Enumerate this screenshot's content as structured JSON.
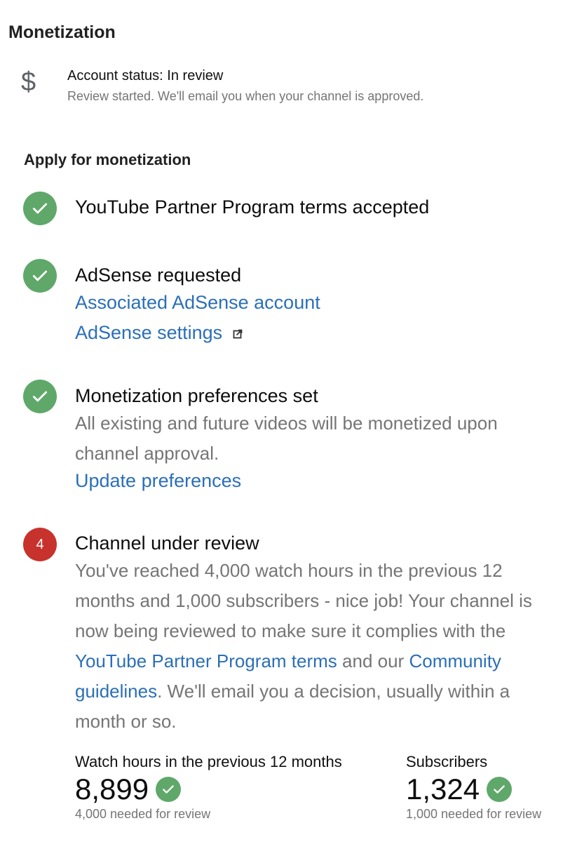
{
  "page": {
    "title": "Monetization"
  },
  "account_status": {
    "icon": "dollar-icon",
    "title": "Account status: In review",
    "description": "Review started. We'll email you when your channel is approved."
  },
  "apply": {
    "heading": "Apply for monetization",
    "steps": [
      {
        "status": "done",
        "icon": "check-icon",
        "title": "YouTube Partner Program terms accepted"
      },
      {
        "status": "done",
        "icon": "check-icon",
        "title": "AdSense requested",
        "links": [
          "Associated AdSense account",
          "AdSense settings"
        ]
      },
      {
        "status": "done",
        "icon": "check-icon",
        "title": "Monetization preferences set",
        "description_lines": [
          "All existing and future videos will be monetized upon",
          "channel approval."
        ],
        "link": "Update preferences"
      },
      {
        "status": "pending",
        "number": "4",
        "title": "Channel under review",
        "description": {
          "line1": "You've reached 4,000 watch hours in the previous 12",
          "line2": "months and 1,000 subscribers - nice job! Your channel is",
          "line3": "now being reviewed to make sure it complies with the",
          "link1": "YouTube Partner Program terms",
          "mid": " and our ",
          "link2a": "Community",
          "link2b": "guidelines",
          "after": ". We'll email you a decision, usually within a",
          "line6": "month or so."
        }
      }
    ]
  },
  "metrics": [
    {
      "label": "Watch hours in the previous 12 months",
      "value": "8,899",
      "requirement": "4,000 needed for review",
      "met": true
    },
    {
      "label": "Subscribers",
      "value": "1,324",
      "requirement": "1,000 needed for review",
      "met": true
    }
  ],
  "colors": {
    "done": "#5fa86a",
    "pending": "#c8322d",
    "link": "#2b6fb8",
    "secondary_text": "#757575"
  }
}
